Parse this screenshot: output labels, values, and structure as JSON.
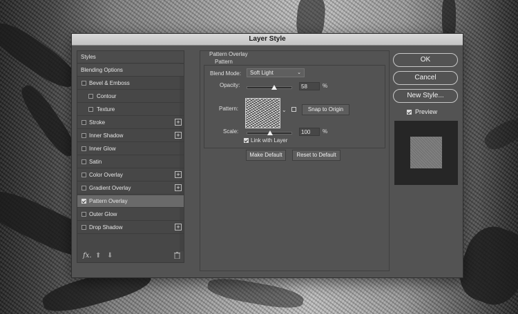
{
  "dialog": {
    "title": "Layer Style"
  },
  "style_list": {
    "items": [
      {
        "label": "Styles",
        "kind": "section"
      },
      {
        "label": "Blending Options",
        "kind": "section"
      },
      {
        "label": "Bevel & Emboss",
        "checked": false
      },
      {
        "label": "Contour",
        "checked": false,
        "indent": true
      },
      {
        "label": "Texture",
        "checked": false,
        "indent": true
      },
      {
        "label": "Stroke",
        "checked": false,
        "plus": true
      },
      {
        "label": "Inner Shadow",
        "checked": false,
        "plus": true
      },
      {
        "label": "Inner Glow",
        "checked": false
      },
      {
        "label": "Satin",
        "checked": false
      },
      {
        "label": "Color Overlay",
        "checked": false,
        "plus": true
      },
      {
        "label": "Gradient Overlay",
        "checked": false,
        "plus": true
      },
      {
        "label": "Pattern Overlay",
        "checked": true,
        "selected": true
      },
      {
        "label": "Outer Glow",
        "checked": false
      },
      {
        "label": "Drop Shadow",
        "checked": false,
        "plus": true
      }
    ],
    "footer": {
      "fx_label": "fx.",
      "up_icon": "arrow-up-icon",
      "down_icon": "arrow-down-icon",
      "trash_icon": "trash-icon"
    }
  },
  "pattern_overlay": {
    "section_title": "Pattern Overlay",
    "group_title": "Pattern",
    "blend_mode_label": "Blend Mode:",
    "blend_mode_value": "Soft Light",
    "opacity_label": "Opacity:",
    "opacity_value": "58",
    "opacity_unit": "%",
    "pattern_label": "Pattern:",
    "snap_to_origin": "Snap to Origin",
    "scale_label": "Scale:",
    "scale_value": "100",
    "scale_unit": "%",
    "link_with_layer_label": "Link with Layer",
    "link_with_layer_checked": true,
    "make_default": "Make Default",
    "reset_to_default": "Reset to Default"
  },
  "actions": {
    "ok": "OK",
    "cancel": "Cancel",
    "new_style": "New Style...",
    "preview_label": "Preview",
    "preview_checked": true
  }
}
